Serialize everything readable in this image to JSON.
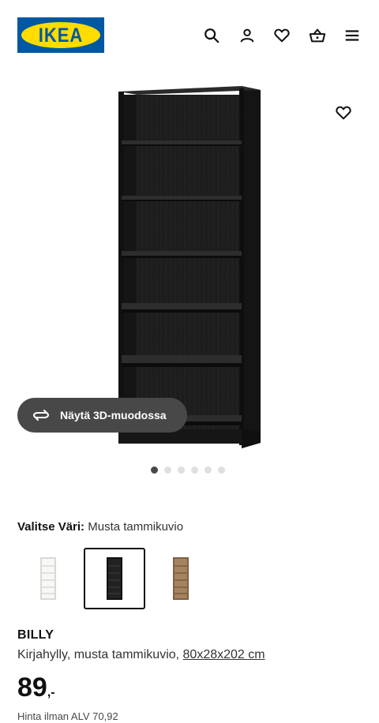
{
  "header": {
    "logo_text": "IKEA",
    "icons": [
      "search-icon",
      "user-icon",
      "heart-icon",
      "basket-icon",
      "menu-icon"
    ]
  },
  "gallery": {
    "view_3d_label": "Näytä 3D-muodossa",
    "dot_count": 6,
    "active_dot": 1
  },
  "color": {
    "label": "Valitse Väri:",
    "value": "Musta tammikuvio",
    "swatches": [
      {
        "name": "white",
        "color": "#f4f4f2",
        "selected": false
      },
      {
        "name": "black-oak",
        "color": "#1e1e1e",
        "selected": true
      },
      {
        "name": "brown-oak",
        "color": "#9a7a5a",
        "selected": false
      }
    ]
  },
  "product": {
    "name": "BILLY",
    "description": "Kirjahylly, musta tammikuvio, ",
    "measurements": "80x28x202 cm",
    "price": "89",
    "price_suffix": ",-",
    "vat_note": "Hinta ilman ALV 70,92"
  },
  "colors": {
    "brand_blue": "#0058a3",
    "brand_yellow": "#ffdb00",
    "pill_bg": "#484848"
  }
}
